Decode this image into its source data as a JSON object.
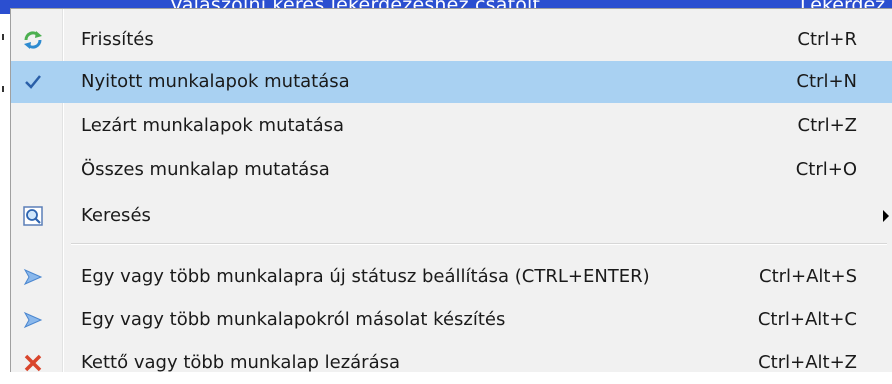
{
  "background": {
    "title_fragment": "Válaszolni kérés lekérdezéshez csatolt",
    "right_fragment": "Lekérdez"
  },
  "menu": {
    "items": [
      {
        "label": "Frissítés",
        "shortcut": "Ctrl+R",
        "icon": "refresh-icon"
      },
      {
        "label": "Nyitott munkalapok mutatása",
        "shortcut": "Ctrl+N",
        "icon": "checkmark-icon",
        "selected": true
      },
      {
        "label": "Lezárt munkalapok mutatása",
        "shortcut": "Ctrl+Z"
      },
      {
        "label": "Összes munkalap mutatása",
        "shortcut": "Ctrl+O"
      },
      {
        "label": "Keresés",
        "shortcut": "",
        "icon": "search-icon",
        "submenu": true
      },
      {
        "label": "Egy vagy több munkalapra új státusz beállítása  (CTRL+ENTER)",
        "shortcut": "Ctrl+Alt+S",
        "icon": "forward-arrow-icon"
      },
      {
        "label": "Egy vagy több munkalapokról másolat készítés",
        "shortcut": "Ctrl+Alt+C",
        "icon": "forward-arrow-icon"
      },
      {
        "label": "Kettő vagy több munkalap lezárása",
        "shortcut": "Ctrl+Alt+Z",
        "icon": "close-x-icon"
      }
    ]
  },
  "colors": {
    "selection": "#a9d1f2",
    "menu_background": "#f1f1f1",
    "title_bar": "#2b4fd0"
  }
}
